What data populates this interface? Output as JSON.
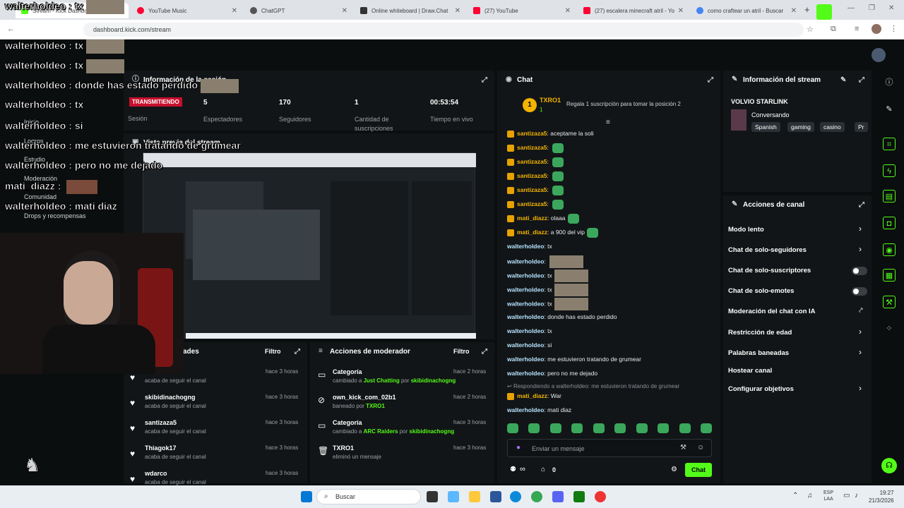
{
  "browser": {
    "tabs": [
      {
        "label": "Stream - Kick Dashboard",
        "color": "#53fc18"
      },
      {
        "label": "YouTube Music",
        "color": "#ff0033"
      },
      {
        "label": "ChatGPT",
        "color": "#444"
      },
      {
        "label": "Online whiteboard | Draw.Chat",
        "color": "#333"
      },
      {
        "label": "(27) YouTube",
        "color": "#ff0033"
      },
      {
        "label": "(27) escalera minecraft atril - Yo",
        "color": "#ff0033"
      },
      {
        "label": "como craftear un atril - Buscar",
        "color": "#4285f4"
      }
    ],
    "url": "dashboard.kick.com/stream"
  },
  "overlay_chat": [
    {
      "user": "walterholdeo",
      "msg": "tx"
    },
    {
      "user": "walterholdeo",
      "msg": "tx"
    },
    {
      "user": "walterholdeo",
      "msg": "tx"
    },
    {
      "user": "walterholdeo",
      "msg": "donde has estado perdido"
    },
    {
      "user": "walterholdeo",
      "msg": "tx"
    },
    {
      "user": "walterholdeo",
      "msg": "si"
    },
    {
      "user": "walterholdeo",
      "msg": "me estuvieron tratando de grumear"
    },
    {
      "user": "walterholdeo",
      "msg": "pero no me dejado"
    },
    {
      "user": "mati_diazz",
      "msg": ""
    },
    {
      "user": "walterholdeo",
      "msg": "mati diaz"
    }
  ],
  "nav": {
    "items": [
      "Inicio",
      "Logros",
      "Estudio",
      "Moderación",
      "Comunidad",
      "Drops y recompensas"
    ],
    "tag": "TRANSMITIENDO"
  },
  "session": {
    "title": "Información de la sesión",
    "stats": [
      {
        "value": "5",
        "label": "Espectadores"
      },
      {
        "value": "170",
        "label": "Seguidores"
      },
      {
        "value": "1",
        "label": "Cantidad de suscripciones"
      },
      {
        "value": "00:53:54",
        "label": "Tiempo en vivo"
      }
    ],
    "first_label": "Sesión"
  },
  "preview": {
    "title": "Vista previa del stream"
  },
  "followers": {
    "title": "ades",
    "filter": "Filtro",
    "items": [
      {
        "name": "",
        "sub": "acaba de seguir el canal",
        "time": "hace 3 horas"
      },
      {
        "name": "skibidinachogng",
        "sub": "acaba de seguir el canal",
        "time": "hace 3 horas"
      },
      {
        "name": "santizaza5",
        "sub": "acaba de seguir el canal",
        "time": "hace 3 horas"
      },
      {
        "name": "Thiagok17",
        "sub": "acaba de seguir el canal",
        "time": "hace 3 horas"
      },
      {
        "name": "wdarco",
        "sub": "acaba de seguir el canal",
        "time": "hace 3 horas"
      }
    ]
  },
  "modactions": {
    "title": "Acciones de moderador",
    "filter": "Filtro",
    "items": [
      {
        "title": "Categoría",
        "line": "cambiado a",
        "hl1": "Just Chatting",
        "mid": "por",
        "hl2": "skibidinachogng",
        "time": "hace 2 horas"
      },
      {
        "title": "own_kick_com_02b1",
        "line": "baneado por",
        "hl1": "TXRO1",
        "mid": "",
        "hl2": "",
        "time": "hace 2 horas"
      },
      {
        "title": "Categoría",
        "line": "cambiado a",
        "hl1": "ARC Raiders",
        "mid": "por",
        "hl2": "skibidinachogng",
        "time": "hace 3 horas"
      },
      {
        "title": "TXRO1",
        "line": "eliminó un mensaje",
        "hl1": "",
        "mid": "",
        "hl2": "",
        "time": "hace 3 horas"
      }
    ]
  },
  "chat": {
    "title": "Chat",
    "pinned_user": "TXRO1",
    "pinned_count": "1",
    "pinned_rank": "1",
    "gift_prompt": "Regala 1 suscripción para tomar la posición 2",
    "messages": [
      {
        "user": "santizaza5",
        "msg": "aceptame la soli",
        "color": "y",
        "badge": true,
        "emote": false,
        "thumb": false
      },
      {
        "user": "santizaza5",
        "msg": "",
        "color": "y",
        "badge": true,
        "emote": true,
        "thumb": false
      },
      {
        "user": "santizaza5",
        "msg": "",
        "color": "y",
        "badge": true,
        "emote": true,
        "thumb": false
      },
      {
        "user": "santizaza5",
        "msg": "",
        "color": "y",
        "badge": true,
        "emote": true,
        "thumb": false
      },
      {
        "user": "santizaza5",
        "msg": "",
        "color": "y",
        "badge": true,
        "emote": true,
        "thumb": false
      },
      {
        "user": "santizaza5",
        "msg": "",
        "color": "y",
        "badge": true,
        "emote": true,
        "thumb": false
      },
      {
        "user": "mati_diazz",
        "msg": "olaaa",
        "color": "y",
        "badge": true,
        "emote": true,
        "thumb": false
      },
      {
        "user": "mati_diazz",
        "msg": "a 900 del vip",
        "color": "y",
        "badge": true,
        "emote": true,
        "thumb": false
      },
      {
        "user": "walterholdeo",
        "msg": "tx",
        "color": "b",
        "badge": false,
        "emote": false,
        "thumb": false
      },
      {
        "user": "walterholdeo",
        "msg": "",
        "color": "b",
        "badge": false,
        "emote": false,
        "thumb": true
      },
      {
        "user": "walterholdeo",
        "msg": "tx",
        "color": "b",
        "badge": false,
        "emote": false,
        "thumb": true
      },
      {
        "user": "walterholdeo",
        "msg": "tx",
        "color": "b",
        "badge": false,
        "emote": false,
        "thumb": true
      },
      {
        "user": "walterholdeo",
        "msg": "tx",
        "color": "b",
        "badge": false,
        "emote": false,
        "thumb": true
      },
      {
        "user": "walterholdeo",
        "msg": "donde has estado perdido",
        "color": "b",
        "badge": false,
        "emote": false,
        "thumb": false
      },
      {
        "user": "walterholdeo",
        "msg": "tx",
        "color": "b",
        "badge": false,
        "emote": false,
        "thumb": false
      },
      {
        "user": "walterholdeo",
        "msg": "si",
        "color": "b",
        "badge": false,
        "emote": false,
        "thumb": false
      },
      {
        "user": "walterholdeo",
        "msg": "me estuvieron tratando de grumear",
        "color": "b",
        "badge": false,
        "emote": false,
        "thumb": false
      },
      {
        "user": "walterholdeo",
        "msg": "pero no me dejado",
        "color": "b",
        "badge": false,
        "emote": false,
        "thumb": false
      }
    ],
    "reply_note": "Respondiendo a walterholdeo: me estuvieron tratando de grumear",
    "reply": {
      "user": "mati_diazz",
      "msg": "War"
    },
    "last": {
      "user": "walterholdeo",
      "msg": "mati diaz"
    },
    "input_placeholder": "Enviar un mensaje",
    "infinity": "∞",
    "points": "0",
    "send": "Chat"
  },
  "streaminfo": {
    "title": "Información del stream",
    "stream_title": "VOLVIO STARLINK",
    "category": "Conversando",
    "tags": [
      "Spanish",
      "gaming",
      "casino",
      "Pr"
    ]
  },
  "channel_actions": {
    "title": "Acciones de canal",
    "items": [
      {
        "label": "Modo lento",
        "kind": "chev"
      },
      {
        "label": "Chat de solo-seguidores",
        "kind": "chev"
      },
      {
        "label": "Chat de solo-suscriptores",
        "kind": "toggle"
      },
      {
        "label": "Chat de solo-emotes",
        "kind": "toggle"
      },
      {
        "label": "Moderación del chat con IA",
        "kind": "ext"
      },
      {
        "label": "Restricción de edad",
        "kind": "chev"
      },
      {
        "label": "Palabras baneadas",
        "kind": "chev"
      },
      {
        "label": "Hostear canal",
        "kind": "none"
      },
      {
        "label": "Configurar objetivos",
        "kind": "chev"
      }
    ]
  },
  "taskbar": {
    "search": "Buscar",
    "lang": "ESP",
    "lang2": "LAA",
    "time": "19:27",
    "date": "21/3/2026"
  },
  "colors": {
    "accent": "#53fc18",
    "panel": "#121517",
    "bg": "#0b0e0f"
  }
}
